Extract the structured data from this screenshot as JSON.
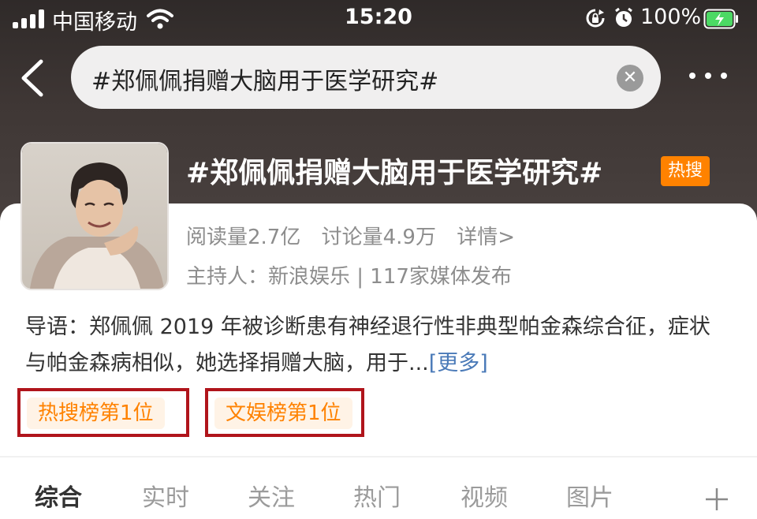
{
  "status_bar": {
    "carrier": "中国移动",
    "time": "15:20",
    "battery": "100%"
  },
  "search": {
    "query": "#郑佩佩捐赠大脑用于医学研究#"
  },
  "topic": {
    "title": "#郑佩佩捐赠大脑用于医学研究#",
    "hot_badge": "热搜",
    "reads": "阅读量2.7亿",
    "discussions": "讨论量4.9万",
    "details": "详情>",
    "host": "主持人：新浪娱乐 | 117家媒体发布",
    "intro": "导语：郑佩佩 2019 年被诊断患有神经退行性非典型帕金森综合征，症状与帕金森病相似，她选择捐赠大脑，用于...",
    "more": "[更多]",
    "rank_tags": [
      "热搜榜第1位",
      "文娱榜第1位"
    ]
  },
  "tabs": [
    {
      "label": "综合",
      "active": true
    },
    {
      "label": "实时",
      "active": false
    },
    {
      "label": "关注",
      "active": false
    },
    {
      "label": "热门",
      "active": false
    },
    {
      "label": "视频",
      "active": false
    },
    {
      "label": "图片",
      "active": false
    }
  ],
  "colors": {
    "accent_orange": "#ff8200",
    "highlight_border": "#b0141b",
    "link_blue": "#4a7ab8"
  },
  "icons": [
    "signal-icon",
    "wifi-icon",
    "rotation-lock-icon",
    "alarm-icon",
    "battery-charging-icon",
    "back-arrow-icon",
    "clear-icon",
    "more-icon",
    "plus-icon"
  ]
}
